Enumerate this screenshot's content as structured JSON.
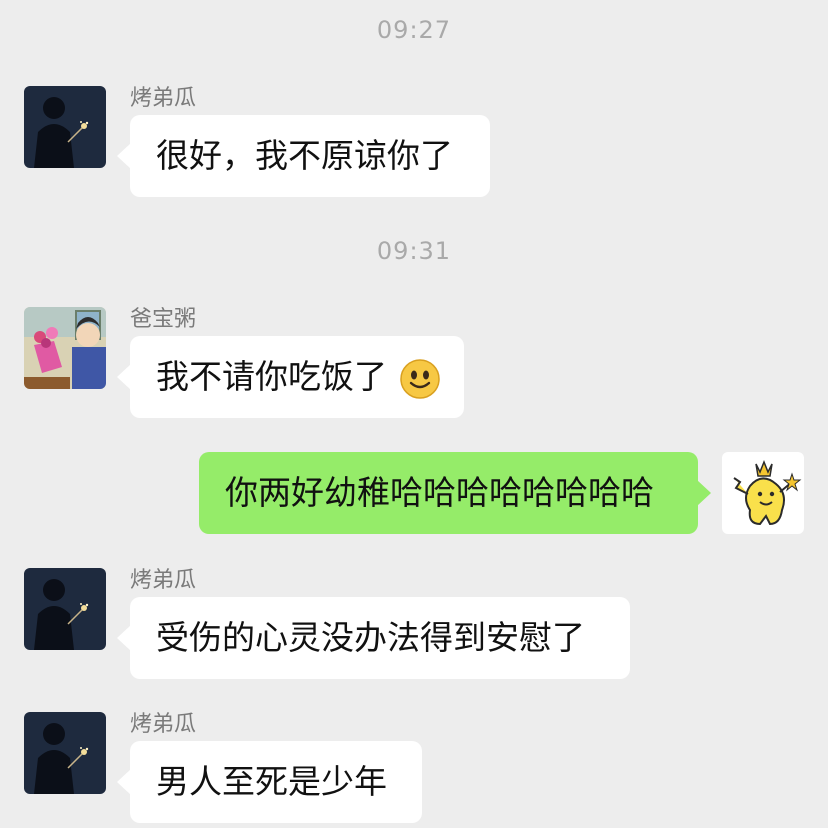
{
  "chat": {
    "timestamps": [
      "09:27",
      "09:31"
    ],
    "messages": [
      {
        "sender": "烤弟瓜",
        "text": "很好，我不原谅你了",
        "side": "left",
        "avatar": "dark-boy-sparkler-avatar"
      },
      {
        "sender": "爸宝粥",
        "text": "我不请你吃饭了",
        "side": "left",
        "avatar": "cartoon-bouquet-avatar",
        "emoji": "smile-emoji"
      },
      {
        "sender": "",
        "text": "你两好幼稚哈哈哈哈哈哈哈哈",
        "side": "right",
        "avatar": "yellow-crown-mascot-avatar"
      },
      {
        "sender": "烤弟瓜",
        "text": "受伤的心灵没办法得到安慰了",
        "side": "left",
        "avatar": "dark-boy-sparkler-avatar"
      },
      {
        "sender": "烤弟瓜",
        "text": "男人至死是少年",
        "side": "left",
        "avatar": "dark-boy-sparkler-avatar"
      }
    ]
  },
  "colors": {
    "background": "#ededed",
    "incoming_bubble": "#ffffff",
    "outgoing_bubble": "#95ec69",
    "timestamp": "#a9a9a9",
    "sender_name": "#7a7a7a"
  }
}
